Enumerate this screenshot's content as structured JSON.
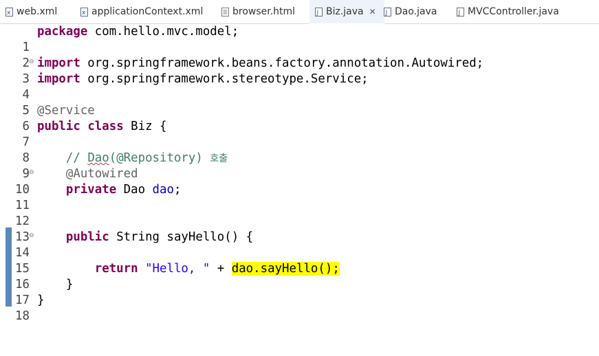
{
  "tabs": [
    {
      "label": "web.xml",
      "icon": "xml-file-icon",
      "active": false
    },
    {
      "label": "applicationContext.xml",
      "icon": "xml-file-icon",
      "active": false
    },
    {
      "label": "browser.html",
      "icon": "html-file-icon",
      "active": false
    },
    {
      "label": "Biz.java",
      "icon": "java-file-icon",
      "active": true,
      "close": "✕"
    },
    {
      "label": "Dao.java",
      "icon": "java-file-icon",
      "active": false
    },
    {
      "label": "MVCController.java",
      "icon": "java-file-icon",
      "active": false
    }
  ],
  "colors": {
    "keyword": "#7f0055",
    "annotation": "#646464",
    "comment": "#3f7f5f",
    "string": "#2a00ff",
    "field": "#0000c0",
    "highlight": "#ffff00",
    "change_marker": "#5b88b8"
  },
  "editor": {
    "line_numbers": [
      "1",
      "2",
      "3",
      "4",
      "5",
      "6",
      "7",
      "8",
      "9",
      "10",
      "11",
      "12",
      "13",
      "14",
      "15",
      "16",
      "17",
      "18"
    ],
    "fold_marker": "⊖",
    "code": {
      "l1_kw": "package",
      "l1_rest": " com.hello.mvc.model;",
      "l3_kw": "import",
      "l3_rest": " org.springframework.beans.factory.annotation.Autowired;",
      "l4_kw": "import",
      "l4_rest": " org.springframework.stereotype.Service;",
      "l6_ann": "@Service",
      "l7_kw1": "public",
      "l7_kw2": "class",
      "l7_rest": " Biz {",
      "l9_indent": "    ",
      "l9_c1": "// ",
      "l9_c2": "Dao",
      "l9_c3": "(@Repository) ",
      "l9_c4": "호출",
      "l10_indent": "    ",
      "l10_ann": "@Autowired",
      "l11_indent": "    ",
      "l11_kw": "private",
      "l11_type": " Dao ",
      "l11_field": "dao",
      "l11_end": ";",
      "l14_indent": "    ",
      "l14_kw": "public",
      "l14_rest": " String sayHello() {",
      "l16_indent": "        ",
      "l16_kw": "return",
      "l16_sp": " ",
      "l16_str": "\"Hello, \"",
      "l16_plus": " + ",
      "l16_hl_field": "dao",
      "l16_hl_rest": ".sayHello();",
      "l17_indent": "    ",
      "l17_brace": "}",
      "l18_brace": "}"
    }
  }
}
